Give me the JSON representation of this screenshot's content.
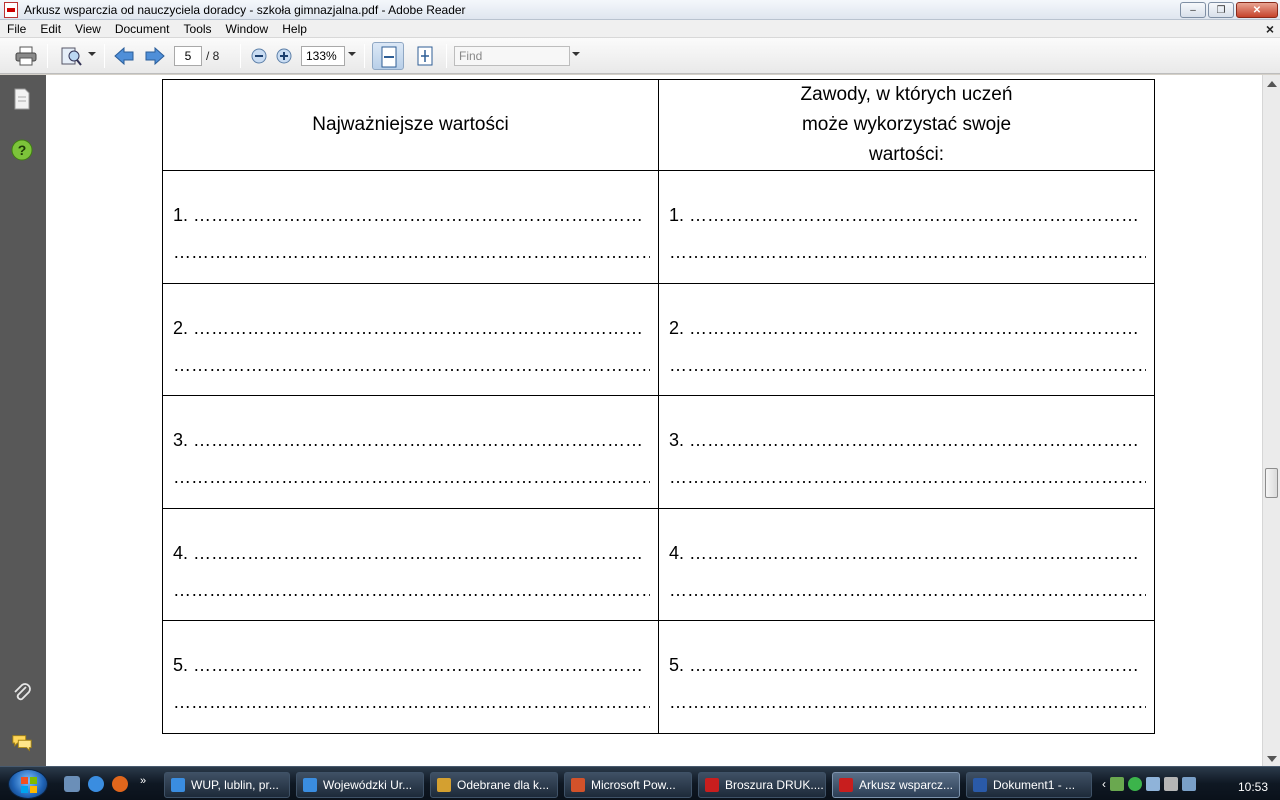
{
  "window": {
    "title": "Arkusz wsparczia od nauczyciela doradcy - szkoła gimnazjalna.pdf - Adobe Reader",
    "minimize": "–",
    "maximize": "❐",
    "close": "✕"
  },
  "menu": {
    "items": [
      "File",
      "Edit",
      "View",
      "Document",
      "Tools",
      "Window",
      "Help"
    ],
    "close_doc": "×"
  },
  "toolbar": {
    "page_current": "5",
    "page_total": "/ 8",
    "zoom": "133%",
    "find_placeholder": "Find"
  },
  "document": {
    "headers": [
      "Najważniejsze wartości",
      "Zawody, w których uczeń może wykorzystać swoje wartości:"
    ],
    "rows": [
      {
        "left_1": "1. …………………………………………………………………",
        "left_2": "…………………………………………………………………………",
        "right_1": "1. …………………………………………………………………",
        "right_2": "…………………………………………………………………………"
      },
      {
        "left_1": "2. …………………………………………………………………",
        "left_2": "…………………………………………………………………………",
        "right_1": "2. …………………………………………………………………",
        "right_2": "…………………………………………………………………………"
      },
      {
        "left_1": "3. …………………………………………………………………",
        "left_2": "…………………………………………………………………………",
        "right_1": "3. …………………………………………………………………",
        "right_2": "…………………………………………………………………………"
      },
      {
        "left_1": "4. …………………………………………………………………",
        "left_2": "…………………………………………………………………………",
        "right_1": "4. …………………………………………………………………",
        "right_2": "…………………………………………………………………………"
      },
      {
        "left_1": "5. …………………………………………………………………",
        "left_2": "…………………………………………………………………………",
        "right_1": "5. …………………………………………………………………",
        "right_2": "…………………………………………………………………………"
      }
    ]
  },
  "taskbar": {
    "tasks": [
      {
        "label": "WUP, lublin, pr...",
        "icon_color": "#3a8de0"
      },
      {
        "label": "Wojewódzki Ur...",
        "icon_color": "#3a8de0"
      },
      {
        "label": "Odebrane dla k...",
        "icon_color": "#d4a030"
      },
      {
        "label": "Microsoft Pow...",
        "icon_color": "#d2522a"
      },
      {
        "label": "Broszura DRUK....",
        "icon_color": "#c81e1e"
      },
      {
        "label": "Arkusz wsparcz...",
        "icon_color": "#c81e1e"
      },
      {
        "label": "Dokument1 - ...",
        "icon_color": "#2a5aa8"
      }
    ],
    "clock": "10:53"
  }
}
